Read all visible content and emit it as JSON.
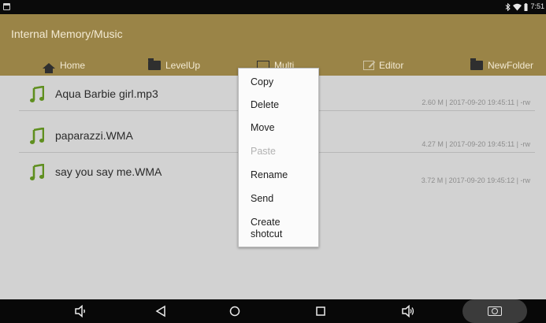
{
  "status_bar": {
    "time": "7:51",
    "icons": [
      "notification-icon",
      "bluetooth-icon",
      "wifi-icon",
      "battery-icon"
    ]
  },
  "header": {
    "path": "Internal Memory/Music",
    "toolbar": [
      {
        "label": "Home",
        "icon": "home-icon"
      },
      {
        "label": "LevelUp",
        "icon": "folder-up-icon"
      },
      {
        "label": "Multi",
        "icon": "multi-select-icon"
      },
      {
        "label": "Editor",
        "icon": "edit-icon"
      },
      {
        "label": "NewFolder",
        "icon": "new-folder-icon"
      }
    ]
  },
  "files": [
    {
      "name": "Aqua  Barbie girl.mp3",
      "meta": "2.60 M | 2017-09-20 19:45:11 | -rw",
      "icon": "music-note-icon"
    },
    {
      "name": "paparazzi.WMA",
      "meta": "4.27 M | 2017-09-20 19:45:11 | -rw",
      "icon": "music-note-icon"
    },
    {
      "name": "say you say me.WMA",
      "meta": "3.72 M | 2017-09-20 19:45:12 | -rw",
      "icon": "music-note-icon"
    }
  ],
  "context_menu": {
    "items": [
      {
        "label": "Copy",
        "enabled": true
      },
      {
        "label": "Delete",
        "enabled": true
      },
      {
        "label": "Move",
        "enabled": true
      },
      {
        "label": "Paste",
        "enabled": false
      },
      {
        "label": "Rename",
        "enabled": true
      },
      {
        "label": "Send",
        "enabled": true
      },
      {
        "label": "Create\nshotcut",
        "enabled": true
      }
    ]
  },
  "nav_bar": {
    "icons": [
      "volume-down-icon",
      "back-icon",
      "home-circle-icon",
      "recents-icon",
      "volume-up-icon",
      "screenshot-icon"
    ]
  },
  "colors": {
    "header_bg": "#9a8447",
    "content_bg": "#d2d2d2",
    "note_icon": "#5f8f1f"
  }
}
